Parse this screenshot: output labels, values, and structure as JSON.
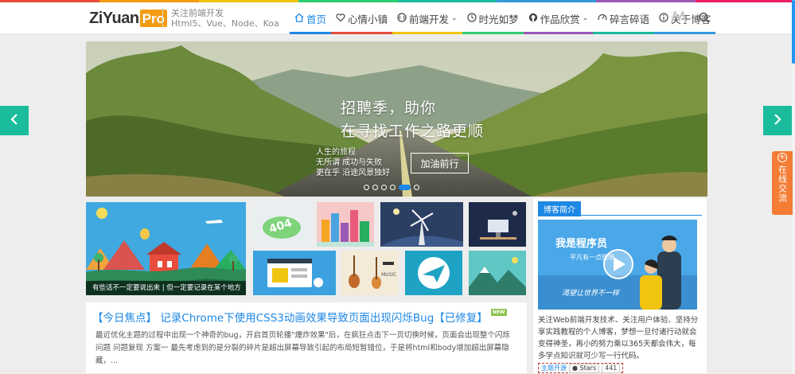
{
  "colors": {
    "rainbow": [
      "#e74c3c",
      "#f39c12",
      "#f1c40f",
      "#2ecc71",
      "#1abc9c",
      "#3498db",
      "#9b59b6",
      "#e91e63"
    ],
    "accent": "#1e88e5",
    "teal": "#1abc9c",
    "orange": "#f47c34"
  },
  "brand": {
    "name": "ZiYuan",
    "badge": "Pro"
  },
  "slogan": {
    "line1": "关注前端开发",
    "line2": "Html5、Vue、Node、Koa"
  },
  "nav": [
    {
      "label": "首页",
      "icon": "home-icon",
      "active": true,
      "bar": "#1e88e5"
    },
    {
      "label": "心情小镇",
      "icon": "heart-icon",
      "bar": "#e74c3c"
    },
    {
      "label": "前端开发",
      "icon": "code-icon",
      "dropdown": true,
      "bar": "#f1c40f"
    },
    {
      "label": "时光如梦",
      "icon": "clock-icon",
      "bar": "#2ecc71"
    },
    {
      "label": "作品欣赏",
      "icon": "github-icon",
      "dropdown": true,
      "bar": "#9b59b6"
    },
    {
      "label": "碎言碎语",
      "icon": "gauge-icon",
      "bar": "#1abc9c"
    },
    {
      "label": "关于博客",
      "icon": "info-icon",
      "bar": "#3498db"
    }
  ],
  "banner": {
    "title_line1": "招聘季，助你",
    "title_line2": "在寻找工作之路更顺",
    "sub_line1": "人生的旅程",
    "sub_line2": "无所谓 成功与失败",
    "sub_line3": "更在乎 沿途风景独好",
    "button": "加油前行",
    "dot_count": 6,
    "active_dot": 4
  },
  "float_chat": {
    "label": "在线交流"
  },
  "feature": {
    "caption": "有些话不一定要说出来 | 但一定要记录在某个地方"
  },
  "post": {
    "title": "【今日焦点】 记录Chrome下使用CSS3动画效果导致页面出现闪烁Bug【已修复】",
    "badge": "NEW",
    "excerpt": "最近优化主题的过程中出现一个神奇的bug，开启首页轮播\"爆炸效果\"后，在疯狂点击下一页切换时候，页面会出现整个闪烁问题 问题复现 方案一 最先考虑到的是分裂的碎片是超出屏幕导致引起的布局短暂错位，于是将html和body增加超出屏幕隐藏，..."
  },
  "sidebar": {
    "heading": "博客简介",
    "image_title": "我是程序员",
    "image_sub": "平凡有一点理想",
    "image_slogan": "渴望让世界不一样",
    "text": "关注Web前端开发技术、关注用户体验、坚持分享实践教程的个人博客，梦想一旦付诸行动就会变得神圣，再小的努力乘以365天都会伟大，每多学点知识就可少写一行代码。",
    "github_label": "主题开源",
    "stars_label": "Stars",
    "stars_count": "441"
  }
}
